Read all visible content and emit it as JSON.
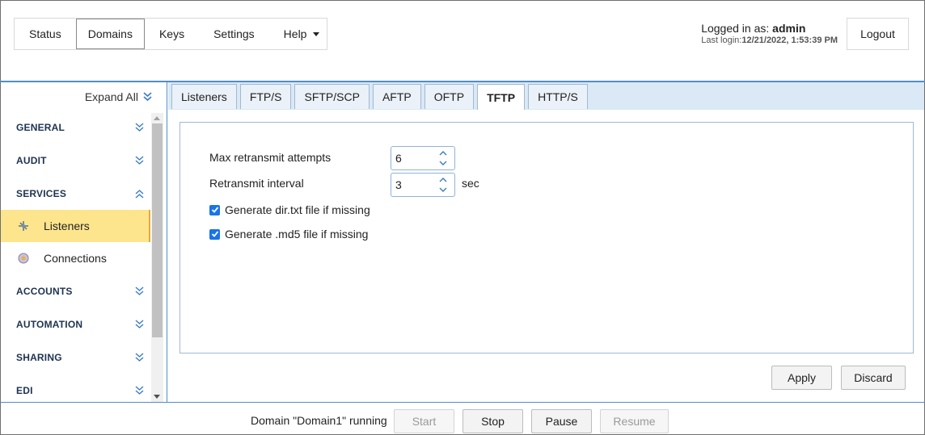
{
  "nav": {
    "items": [
      "Status",
      "Domains",
      "Keys",
      "Settings"
    ],
    "help_label": "Help",
    "active": "Domains"
  },
  "user": {
    "logged_in_prefix": "Logged in as:",
    "username": "admin",
    "last_login_label": "Last login:",
    "last_login_value": "12/21/2022, 1:53:39 PM",
    "logout_label": "Logout"
  },
  "sidebar": {
    "expand_all_label": "Expand All",
    "sections": [
      {
        "label": "GENERAL",
        "expanded": false
      },
      {
        "label": "AUDIT",
        "expanded": false
      },
      {
        "label": "SERVICES",
        "expanded": true
      },
      {
        "label": "ACCOUNTS",
        "expanded": false
      },
      {
        "label": "AUTOMATION",
        "expanded": false
      },
      {
        "label": "SHARING",
        "expanded": false
      },
      {
        "label": "EDI",
        "expanded": false
      }
    ],
    "items": [
      {
        "label": "Listeners",
        "icon": "listeners-icon",
        "active": true
      },
      {
        "label": "Connections",
        "icon": "connections-icon",
        "active": false
      }
    ]
  },
  "tabs": [
    "Listeners",
    "FTP/S",
    "SFTP/SCP",
    "AFTP",
    "OFTP",
    "TFTP",
    "HTTP/S"
  ],
  "active_tab": "TFTP",
  "form": {
    "max_retransmit_label": "Max retransmit attempts",
    "max_retransmit_value": "6",
    "retransmit_interval_label": "Retransmit interval",
    "retransmit_interval_value": "3",
    "retransmit_interval_unit": "sec",
    "gen_dir_label": "Generate dir.txt file if missing",
    "gen_dir_checked": true,
    "gen_md5_label": "Generate .md5 file if missing",
    "gen_md5_checked": true
  },
  "actions": {
    "apply_label": "Apply",
    "discard_label": "Discard"
  },
  "footer": {
    "status": "Domain \"Domain1\" running",
    "start_label": "Start",
    "stop_label": "Stop",
    "pause_label": "Pause",
    "resume_label": "Resume"
  },
  "colors": {
    "accent_blue": "#4f8fc7",
    "active_sidebar": "#fde58d",
    "checkbox": "#1a73e8"
  }
}
